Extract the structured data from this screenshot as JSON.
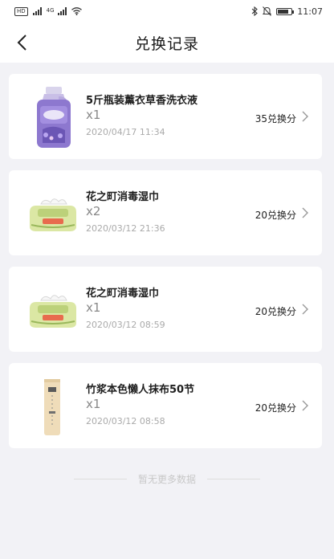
{
  "status_bar": {
    "hd_label": "HD",
    "sim_label": "4G",
    "time": "11:07",
    "icons": [
      "signal-icon",
      "wifi-icon",
      "bluetooth-icon",
      "mute-icon",
      "battery-icon"
    ]
  },
  "header": {
    "title": "兑换记录",
    "back_icon": "back-arrow-icon"
  },
  "records": [
    {
      "name": "5斤瓶装薰衣草香洗衣液",
      "qty": "x1",
      "date": "2020/04/17 11:34",
      "points": "35兑换分",
      "image": "laundry-detergent-bottle"
    },
    {
      "name": "花之町消毒湿巾",
      "qty": "x2",
      "date": "2020/03/12 21:36",
      "points": "20兑换分",
      "image": "wet-wipes-pack"
    },
    {
      "name": "花之町消毒湿巾",
      "qty": "x1",
      "date": "2020/03/12 08:59",
      "points": "20兑换分",
      "image": "wet-wipes-pack"
    },
    {
      "name": "竹浆本色懒人抹布50节",
      "qty": "x1",
      "date": "2020/03/12 08:58",
      "points": "20兑换分",
      "image": "bamboo-towel-roll"
    }
  ],
  "footer": {
    "no_more": "暂无更多数据"
  }
}
